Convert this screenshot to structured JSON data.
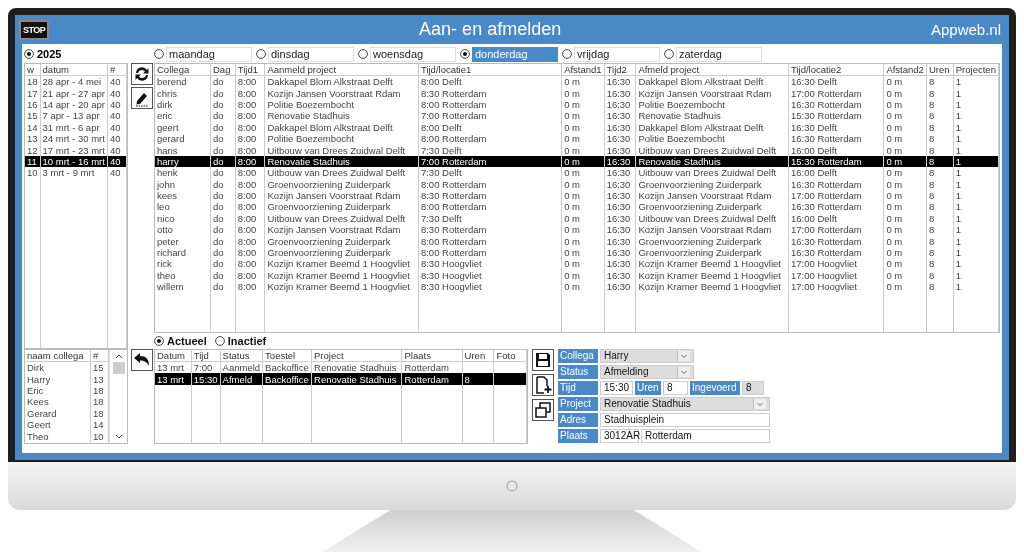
{
  "window": {
    "title": "Aan- en afmelden",
    "brand": "Appweb.nl",
    "stop_button": "STOP"
  },
  "year": {
    "label": "2025",
    "selected": true
  },
  "days": [
    {
      "label": "maandag",
      "selected": false
    },
    {
      "label": "dinsdag",
      "selected": false
    },
    {
      "label": "woensdag",
      "selected": false
    },
    {
      "label": "donderdag",
      "selected": true
    },
    {
      "label": "vrijdag",
      "selected": false
    },
    {
      "label": "zaterdag",
      "selected": false
    }
  ],
  "weeks": {
    "columns": [
      "w",
      "datum",
      "#"
    ],
    "rows": [
      {
        "cells": [
          "18",
          "28 apr - 4 mei",
          "40"
        ],
        "selected": false
      },
      {
        "cells": [
          "17",
          "21 apr - 27 apr",
          "40"
        ],
        "selected": false
      },
      {
        "cells": [
          "16",
          "14 apr - 20 apr",
          "40"
        ],
        "selected": false
      },
      {
        "cells": [
          "15",
          "7 apr - 13 apr",
          "40"
        ],
        "selected": false
      },
      {
        "cells": [
          "14",
          "31 mrt - 6 apr",
          "40"
        ],
        "selected": false
      },
      {
        "cells": [
          "13",
          "24 mrt - 30 mrt",
          "40"
        ],
        "selected": false
      },
      {
        "cells": [
          "12",
          "17 mrt - 23 mrt",
          "40"
        ],
        "selected": false
      },
      {
        "cells": [
          "11",
          "10 mrt - 16 mrt",
          "40"
        ],
        "selected": true
      },
      {
        "cells": [
          "10",
          "3 mrt - 9 mrt",
          "40"
        ],
        "selected": false
      }
    ]
  },
  "table": {
    "columns": [
      "Collega",
      "Dag",
      "Tijd1",
      "Aanmeld project",
      "Tijd/locatie1",
      "Afstand1",
      "Tijd2",
      "Afmeld project",
      "Tijd/locatie2",
      "Afstand2",
      "Uren",
      "Projecten"
    ],
    "rows": [
      {
        "cells": [
          "berend",
          "do",
          "8:00",
          "Dakkapel Blom Alkstraat Delft",
          "8:00 Delft",
          "0 m",
          "16:30",
          "Dakkapel Blom Alkstraat Delft",
          "16:30 Delft",
          "0 m",
          "8",
          "1"
        ],
        "selected": false
      },
      {
        "cells": [
          "chris",
          "do",
          "8:00",
          "Kozijn Jansen Voorstraat Rdam",
          "8:30 Rotterdam",
          "0 m",
          "16:30",
          "Kozijn Jansen Voorstraat Rdam",
          "17:00 Rotterdam",
          "0 m",
          "8",
          "1"
        ],
        "selected": false
      },
      {
        "cells": [
          "dirk",
          "do",
          "8:00",
          "Politie Boezembocht",
          "8:00 Rotterdam",
          "0 m",
          "16:30",
          "Politie Boezembocht",
          "16:30 Rotterdam",
          "0 m",
          "8",
          "1"
        ],
        "selected": false
      },
      {
        "cells": [
          "eric",
          "do",
          "8:00",
          "Renovatie Stadhuis",
          "7:00 Rotterdam",
          "0 m",
          "16:30",
          "Renovatie Stadhuis",
          "15:30 Rotterdam",
          "0 m",
          "8",
          "1"
        ],
        "selected": false
      },
      {
        "cells": [
          "geert",
          "do",
          "8:00",
          "Dakkapel Blom Alkstraat Delft",
          "8:00 Delft",
          "0 m",
          "16:30",
          "Dakkapel Blom Alkstraat Delft",
          "16:30 Delft",
          "0 m",
          "8",
          "1"
        ],
        "selected": false
      },
      {
        "cells": [
          "gerard",
          "do",
          "8:00",
          "Politie Boezembocht",
          "8:00 Rotterdam",
          "0 m",
          "16:30",
          "Politie Boezembocht",
          "16:30 Rotterdam",
          "0 m",
          "8",
          "1"
        ],
        "selected": false
      },
      {
        "cells": [
          "hans",
          "do",
          "8:00",
          "Uitbouw van Drees Zuidwal Delft",
          "7:30 Delft",
          "0 m",
          "16:30",
          "Uitbouw van Drees Zuidwal Delft",
          "16:00 Delft",
          "0 m",
          "8",
          "1"
        ],
        "selected": false
      },
      {
        "cells": [
          "harry",
          "do",
          "8:00",
          "Renovatie Stadhuis",
          "7:00 Rotterdam",
          "0 m",
          "16:30",
          "Renovatie Stadhuis",
          "15:30 Rotterdam",
          "0 m",
          "8",
          "1"
        ],
        "selected": true
      },
      {
        "cells": [
          "henk",
          "do",
          "8:00",
          "Uitbouw van Drees Zuidwal Delft",
          "7:30 Delft",
          "0 m",
          "16:30",
          "Uitbouw van Drees Zuidwal Delft",
          "16:00 Delft",
          "0 m",
          "8",
          "1"
        ],
        "selected": false
      },
      {
        "cells": [
          "john",
          "do",
          "8:00",
          "Groenvoorziening Zuiderpark",
          "8:00 Rotterdam",
          "0 m",
          "16:30",
          "Groenvoorziening Zuiderpark",
          "16:30 Rotterdam",
          "0 m",
          "8",
          "1"
        ],
        "selected": false
      },
      {
        "cells": [
          "kees",
          "do",
          "8:00",
          "Kozijn Jansen Voorstraat Rdam",
          "8:30 Rotterdam",
          "0 m",
          "16:30",
          "Kozijn Jansen Voorstraat Rdam",
          "17:00 Rotterdam",
          "0 m",
          "8",
          "1"
        ],
        "selected": false
      },
      {
        "cells": [
          "leo",
          "do",
          "8:00",
          "Groenvoorziening Zuiderpark",
          "8:00 Rotterdam",
          "0 m",
          "16:30",
          "Groenvoorziening Zuiderpark",
          "16:30 Rotterdam",
          "0 m",
          "8",
          "1"
        ],
        "selected": false
      },
      {
        "cells": [
          "nico",
          "do",
          "8:00",
          "Uitbouw van Drees Zuidwal Delft",
          "7:30 Delft",
          "0 m",
          "16:30",
          "Uitbouw van Drees Zuidwal Delft",
          "16:00 Delft",
          "0 m",
          "8",
          "1"
        ],
        "selected": false
      },
      {
        "cells": [
          "otto",
          "do",
          "8:00",
          "Kozijn Jansen Voorstraat Rdam",
          "8:30 Rotterdam",
          "0 m",
          "16:30",
          "Kozijn Jansen Voorstraat Rdam",
          "17:00 Rotterdam",
          "0 m",
          "8",
          "1"
        ],
        "selected": false
      },
      {
        "cells": [
          "peter",
          "do",
          "8:00",
          "Groenvoorziening Zuiderpark",
          "8:00 Rotterdam",
          "0 m",
          "16:30",
          "Groenvoorziening Zuiderpark",
          "16:30 Rotterdam",
          "0 m",
          "8",
          "1"
        ],
        "selected": false
      },
      {
        "cells": [
          "richard",
          "do",
          "8:00",
          "Groenvoorziening Zuiderpark",
          "8:00 Rotterdam",
          "0 m",
          "16:30",
          "Groenvoorziening Zuiderpark",
          "16:30 Rotterdam",
          "0 m",
          "8",
          "1"
        ],
        "selected": false
      },
      {
        "cells": [
          "rick",
          "do",
          "8:00",
          "Kozijn Kramer Beemd 1 Hoogvliet",
          "8:30 Hoogvliet",
          "0 m",
          "16:30",
          "Kozijn Kramer Beemd 1 Hoogvliet",
          "17:00 Hoogvliet",
          "0 m",
          "8",
          "1"
        ],
        "selected": false
      },
      {
        "cells": [
          "theo",
          "do",
          "8:00",
          "Kozijn Kramer Beemd 1 Hoogvliet",
          "8:30 Hoogvliet",
          "0 m",
          "16:30",
          "Kozijn Kramer Beemd 1 Hoogvliet",
          "17:00 Hoogvliet",
          "0 m",
          "8",
          "1"
        ],
        "selected": false
      },
      {
        "cells": [
          "willem",
          "do",
          "8:00",
          "Kozijn Kramer Beemd 1 Hoogvliet",
          "8:30 Hoogvliet",
          "0 m",
          "16:30",
          "Kozijn Kramer Beemd 1 Hoogvliet",
          "17:00 Hoogvliet",
          "0 m",
          "8",
          "1"
        ],
        "selected": false
      }
    ]
  },
  "filter": [
    {
      "label": "Actueel",
      "selected": true
    },
    {
      "label": "Inactief",
      "selected": false
    }
  ],
  "colleagues": {
    "columns": [
      "naam collega",
      "#"
    ],
    "rows": [
      {
        "cells": [
          "Dirk",
          "15"
        ]
      },
      {
        "cells": [
          "Harry",
          "13"
        ]
      },
      {
        "cells": [
          "Eric",
          "18"
        ]
      },
      {
        "cells": [
          "Kees",
          "18"
        ]
      },
      {
        "cells": [
          "Gerard",
          "18"
        ]
      },
      {
        "cells": [
          "Geert",
          "14"
        ]
      },
      {
        "cells": [
          "Theo",
          "10"
        ]
      }
    ]
  },
  "history": {
    "columns": [
      "Datum",
      "Tijd",
      "Status",
      "Toestel",
      "Project",
      "Plaats",
      "Uren",
      "Foto"
    ],
    "rows": [
      {
        "cells": [
          "13 mrt",
          "7:00",
          "Aanmeld",
          "Backoffice",
          "Renovatie Stadhuis",
          "Rotterdam",
          null,
          null
        ],
        "selected": false
      },
      {
        "cells": [
          "13 mrt",
          "15:30",
          "Afmeld",
          "Backoffice",
          "Renovatie Stadhuis",
          "Rotterdam",
          "8",
          null
        ],
        "selected": true
      }
    ]
  },
  "form": {
    "rows": [
      {
        "items": [
          {
            "kind": "label",
            "text": "Collega"
          },
          {
            "kind": "select",
            "value": "Harry"
          }
        ]
      },
      {
        "items": [
          {
            "kind": "label",
            "text": "Status"
          },
          {
            "kind": "select",
            "value": "Afmelding"
          }
        ]
      },
      {
        "items": [
          {
            "kind": "label",
            "text": "Tijd"
          },
          {
            "kind": "input",
            "value": "15:30"
          },
          {
            "kind": "label",
            "text": "Uren"
          },
          {
            "kind": "input",
            "value": "8"
          },
          {
            "kind": "label",
            "text": "Ingevoerd"
          },
          {
            "kind": "readonly",
            "value": "8"
          }
        ]
      },
      {
        "items": [
          {
            "kind": "label",
            "text": "Project"
          },
          {
            "kind": "select",
            "value": "Renovatie Stadhuis"
          }
        ]
      },
      {
        "items": [
          {
            "kind": "label",
            "text": "Adres"
          },
          {
            "kind": "input",
            "value": "Stadhuisplein"
          }
        ]
      },
      {
        "items": [
          {
            "kind": "label",
            "text": "Plaats"
          },
          {
            "kind": "input",
            "value": "3012AR"
          },
          {
            "kind": "input",
            "value": "Rotterdam"
          }
        ]
      }
    ]
  }
}
